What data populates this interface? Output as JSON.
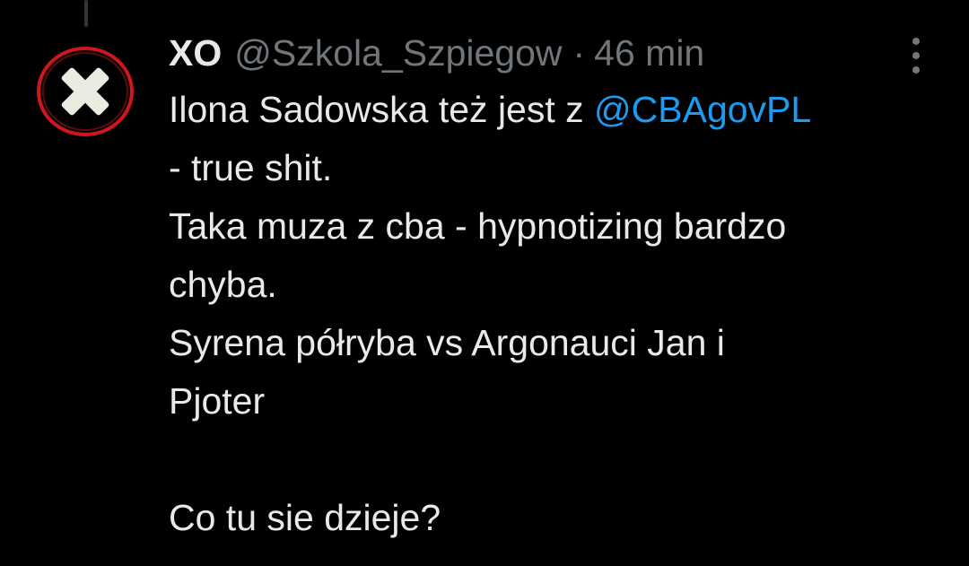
{
  "tweet": {
    "display_name": "XO",
    "handle": "@Szkola_Szpiegow",
    "separator": "·",
    "time": "46 min",
    "text_lines": [
      {
        "before": "Ilona Sadowska też jest z ",
        "mention": "@CBAgovPL"
      },
      {
        "before": "- true shit."
      },
      {
        "before": "Taka muza z cba - hypnotizing bardzo"
      },
      {
        "before": "chyba."
      },
      {
        "before": "Syrena półryba vs Argonauci Jan i"
      },
      {
        "before": "Pjoter"
      },
      {
        "before": ""
      },
      {
        "before": "Co tu sie dzieje?"
      }
    ]
  },
  "colors": {
    "background": "#000000",
    "text": "#e7e9ea",
    "secondary": "#71767b",
    "mention": "#1d9bf0",
    "avatar_ring": "#d0161d"
  },
  "icons": {
    "avatar": "x-cross-avatar-icon",
    "more": "more-vertical-icon"
  }
}
